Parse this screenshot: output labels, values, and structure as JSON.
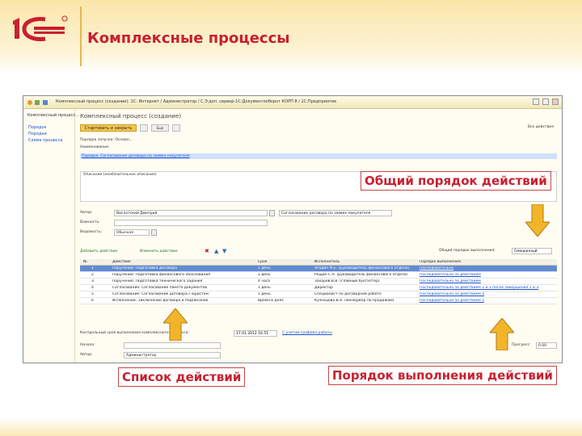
{
  "slide": {
    "title": "Комплексные процессы",
    "brand_color": "#c8202f",
    "accent_color": "#f6c64d"
  },
  "window": {
    "title_text": "Комплексный процесс (создание): 1С: Интернет / Администратор / С.Э.доп. сервер-1С:Документооборот КОРП 8 / 1С:Предприятие",
    "sidebar_title": "Комплексный процесс...",
    "sidebar_links": [
      "Порядок",
      "Порядки",
      "Схема процесса"
    ]
  },
  "form": {
    "title": "Комплексный процесс (создание)",
    "save_button": "Стартовать и закрыть",
    "more_button": "Еще",
    "help_label": "Все действия",
    "field_name_label": "Порядок запуска: Основн...",
    "field_subject_label": "Наименование:",
    "highlighted_link": "Порядок: Согласование договора по заявке покупателя",
    "description_label": "Описание (необязательное описание)",
    "author_label": "Автор:",
    "author_value": "Вислотский Дмитрий",
    "author_extra": "Согласование договора по заявке покупателя",
    "importance_label": "Важность:",
    "importance_value": "",
    "executor_label": "Ведомость:",
    "executor_value": "Обычная",
    "add_action_button": "Добавить действие",
    "change_action_button": "Изменить действие",
    "order_label": "Общий порядок выполнения:",
    "order_value": "Смешанный"
  },
  "grid": {
    "columns": [
      "№",
      "Действие",
      "Срок",
      "Исполнитель",
      "Порядок выполнения"
    ],
    "rows": [
      {
        "num": "1",
        "action": "Поручение: Подготовка договора",
        "term": "1 день",
        "executor": "Ягодин М.Е. (руководитель финансового отдела)",
        "order": "Последовательно"
      },
      {
        "num": "2",
        "action": "Поручение: Подготовка финансового обоснования",
        "term": "1 день",
        "executor": "Рощин С.А. (руководитель финансового отдела)",
        "order": "Последовательно за действием"
      },
      {
        "num": "3",
        "action": "Поручение: Подготовка технического задания",
        "term": "4 часа",
        "executor": "Захаров В.В. (главный бухгалтер)",
        "order": "Последовательно за действием"
      },
      {
        "num": "4",
        "action": "Согласование: Согласование пакета документов",
        "term": "1 день",
        "executor": "Директор",
        "order": "Последовательно за действием 2 и 3 после завершения 1 и 3"
      },
      {
        "num": "5",
        "action": "Согласование: Согласование договора с юристом",
        "term": "1 день",
        "executor": "Специалист по договорной работе",
        "order": "Последовательно за действием 4"
      },
      {
        "num": "6",
        "action": "Исполнение: Заключение договора и подписание",
        "term": "Время в днях",
        "executor": "Кузнецова В.А. (менеджер по продажам)",
        "order": "Последовательно за действием 5"
      }
    ]
  },
  "footer": {
    "deadline_label": "Контрольный срок выполнения комплексного процесса:",
    "deadline_value": "17.01.2012 16:51",
    "deadline_link": "С учетом графика работы",
    "started_label": "Начало:",
    "author_label": "Автор:",
    "author_value": "Администратор",
    "progress_label": "Прогресс:",
    "progress_value": "0.00"
  },
  "callouts": {
    "general_order": "Общий порядок действий",
    "actions_list": "Список действий",
    "execution_order": "Порядок выполнения действий"
  }
}
